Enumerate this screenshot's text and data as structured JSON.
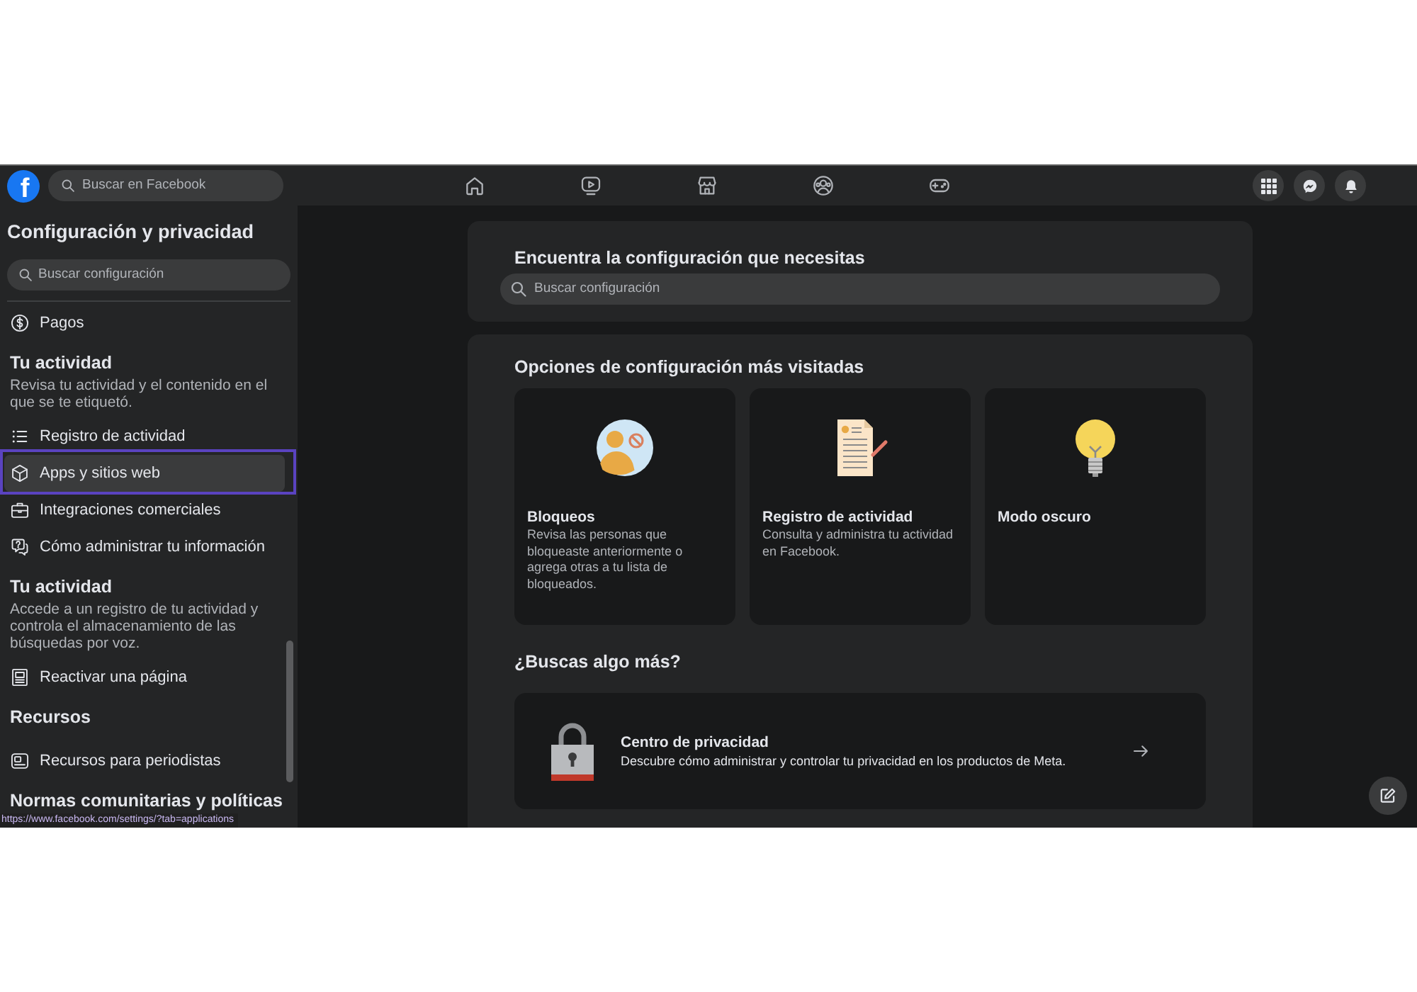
{
  "top_bar": {
    "logo": {
      "text": "f"
    },
    "search": {
      "placeholder": "Buscar en Facebook"
    }
  },
  "sidebar": {
    "title": "Configuración y privacidad",
    "search": {
      "placeholder": "Buscar configuración"
    },
    "entries": [
      {
        "kind": "link",
        "label": "Pagos",
        "selected": false
      },
      {
        "kind": "heading",
        "label": "Tu actividad"
      },
      {
        "kind": "note",
        "label": "Revisa tu actividad y el contenido en el que se te etiquetó."
      },
      {
        "kind": "link",
        "label": "Registro de actividad",
        "selected": false
      },
      {
        "kind": "link",
        "label": "Apps y sitios web",
        "selected": true
      },
      {
        "kind": "link",
        "label": "Integraciones comerciales",
        "selected": false
      },
      {
        "kind": "link",
        "label": "Cómo administrar tu información",
        "selected": false
      },
      {
        "kind": "heading",
        "label": "Tu actividad"
      },
      {
        "kind": "note",
        "label": "Accede a un registro de tu actividad y controla el almacenamiento de las búsquedas por voz."
      },
      {
        "kind": "link",
        "label": "Reactivar una página",
        "selected": false
      },
      {
        "kind": "heading",
        "label": "Recursos"
      },
      {
        "kind": "link",
        "label": "Recursos para periodistas",
        "selected": false
      },
      {
        "kind": "heading",
        "label": "Normas comunitarias y políticas"
      }
    ]
  },
  "status_url": "https://www.facebook.com/settings/?tab=applications",
  "main": {
    "search_card": {
      "title": "Encuentra la configuración que necesitas",
      "search": {
        "placeholder": "Buscar configuración"
      }
    },
    "most_visited": {
      "title": "Opciones de configuración más visitadas",
      "tiles": [
        {
          "title": "Bloqueos",
          "description": "Revisa las personas que bloqueaste anteriormente o agrega otras a tu lista de bloqueados."
        },
        {
          "title": "Registro de actividad",
          "description": "Consulta y administra tu actividad en Facebook."
        },
        {
          "title": "Modo oscuro"
        }
      ]
    },
    "more": {
      "title": "¿Buscas algo más?",
      "cards": [
        {
          "title": "Centro de privacidad",
          "description": "Descubre cómo administrar y controlar tu privacidad en los productos de Meta."
        }
      ]
    }
  }
}
